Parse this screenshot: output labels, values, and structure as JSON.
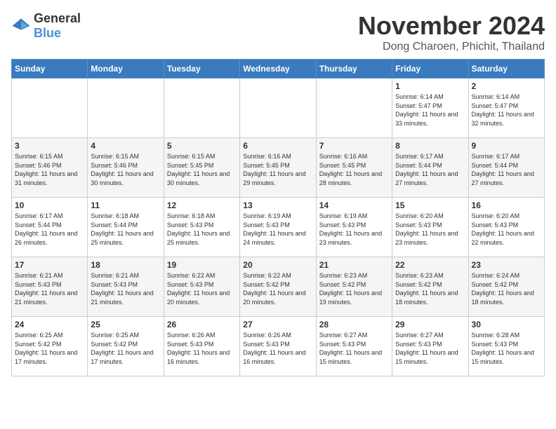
{
  "logo": {
    "general": "General",
    "blue": "Blue"
  },
  "title": "November 2024",
  "location": "Dong Charoen, Phichit, Thailand",
  "days_of_week": [
    "Sunday",
    "Monday",
    "Tuesday",
    "Wednesday",
    "Thursday",
    "Friday",
    "Saturday"
  ],
  "weeks": [
    [
      {
        "day": "",
        "details": ""
      },
      {
        "day": "",
        "details": ""
      },
      {
        "day": "",
        "details": ""
      },
      {
        "day": "",
        "details": ""
      },
      {
        "day": "",
        "details": ""
      },
      {
        "day": "1",
        "details": "Sunrise: 6:14 AM\nSunset: 5:47 PM\nDaylight: 11 hours\nand 33 minutes."
      },
      {
        "day": "2",
        "details": "Sunrise: 6:14 AM\nSunset: 5:47 PM\nDaylight: 11 hours\nand 32 minutes."
      }
    ],
    [
      {
        "day": "3",
        "details": "Sunrise: 6:15 AM\nSunset: 5:46 PM\nDaylight: 11 hours\nand 31 minutes."
      },
      {
        "day": "4",
        "details": "Sunrise: 6:15 AM\nSunset: 5:46 PM\nDaylight: 11 hours\nand 30 minutes."
      },
      {
        "day": "5",
        "details": "Sunrise: 6:15 AM\nSunset: 5:45 PM\nDaylight: 11 hours\nand 30 minutes."
      },
      {
        "day": "6",
        "details": "Sunrise: 6:16 AM\nSunset: 5:45 PM\nDaylight: 11 hours\nand 29 minutes."
      },
      {
        "day": "7",
        "details": "Sunrise: 6:16 AM\nSunset: 5:45 PM\nDaylight: 11 hours\nand 28 minutes."
      },
      {
        "day": "8",
        "details": "Sunrise: 6:17 AM\nSunset: 5:44 PM\nDaylight: 11 hours\nand 27 minutes."
      },
      {
        "day": "9",
        "details": "Sunrise: 6:17 AM\nSunset: 5:44 PM\nDaylight: 11 hours\nand 27 minutes."
      }
    ],
    [
      {
        "day": "10",
        "details": "Sunrise: 6:17 AM\nSunset: 5:44 PM\nDaylight: 11 hours\nand 26 minutes."
      },
      {
        "day": "11",
        "details": "Sunrise: 6:18 AM\nSunset: 5:44 PM\nDaylight: 11 hours\nand 25 minutes."
      },
      {
        "day": "12",
        "details": "Sunrise: 6:18 AM\nSunset: 5:43 PM\nDaylight: 11 hours\nand 25 minutes."
      },
      {
        "day": "13",
        "details": "Sunrise: 6:19 AM\nSunset: 5:43 PM\nDaylight: 11 hours\nand 24 minutes."
      },
      {
        "day": "14",
        "details": "Sunrise: 6:19 AM\nSunset: 5:43 PM\nDaylight: 11 hours\nand 23 minutes."
      },
      {
        "day": "15",
        "details": "Sunrise: 6:20 AM\nSunset: 5:43 PM\nDaylight: 11 hours\nand 23 minutes."
      },
      {
        "day": "16",
        "details": "Sunrise: 6:20 AM\nSunset: 5:43 PM\nDaylight: 11 hours\nand 22 minutes."
      }
    ],
    [
      {
        "day": "17",
        "details": "Sunrise: 6:21 AM\nSunset: 5:43 PM\nDaylight: 11 hours\nand 21 minutes."
      },
      {
        "day": "18",
        "details": "Sunrise: 6:21 AM\nSunset: 5:43 PM\nDaylight: 11 hours\nand 21 minutes."
      },
      {
        "day": "19",
        "details": "Sunrise: 6:22 AM\nSunset: 5:43 PM\nDaylight: 11 hours\nand 20 minutes."
      },
      {
        "day": "20",
        "details": "Sunrise: 6:22 AM\nSunset: 5:42 PM\nDaylight: 11 hours\nand 20 minutes."
      },
      {
        "day": "21",
        "details": "Sunrise: 6:23 AM\nSunset: 5:42 PM\nDaylight: 11 hours\nand 19 minutes."
      },
      {
        "day": "22",
        "details": "Sunrise: 6:23 AM\nSunset: 5:42 PM\nDaylight: 11 hours\nand 18 minutes."
      },
      {
        "day": "23",
        "details": "Sunrise: 6:24 AM\nSunset: 5:42 PM\nDaylight: 11 hours\nand 18 minutes."
      }
    ],
    [
      {
        "day": "24",
        "details": "Sunrise: 6:25 AM\nSunset: 5:42 PM\nDaylight: 11 hours\nand 17 minutes."
      },
      {
        "day": "25",
        "details": "Sunrise: 6:25 AM\nSunset: 5:42 PM\nDaylight: 11 hours\nand 17 minutes."
      },
      {
        "day": "26",
        "details": "Sunrise: 6:26 AM\nSunset: 5:43 PM\nDaylight: 11 hours\nand 16 minutes."
      },
      {
        "day": "27",
        "details": "Sunrise: 6:26 AM\nSunset: 5:43 PM\nDaylight: 11 hours\nand 16 minutes."
      },
      {
        "day": "28",
        "details": "Sunrise: 6:27 AM\nSunset: 5:43 PM\nDaylight: 11 hours\nand 15 minutes."
      },
      {
        "day": "29",
        "details": "Sunrise: 6:27 AM\nSunset: 5:43 PM\nDaylight: 11 hours\nand 15 minutes."
      },
      {
        "day": "30",
        "details": "Sunrise: 6:28 AM\nSunset: 5:43 PM\nDaylight: 11 hours\nand 15 minutes."
      }
    ]
  ]
}
